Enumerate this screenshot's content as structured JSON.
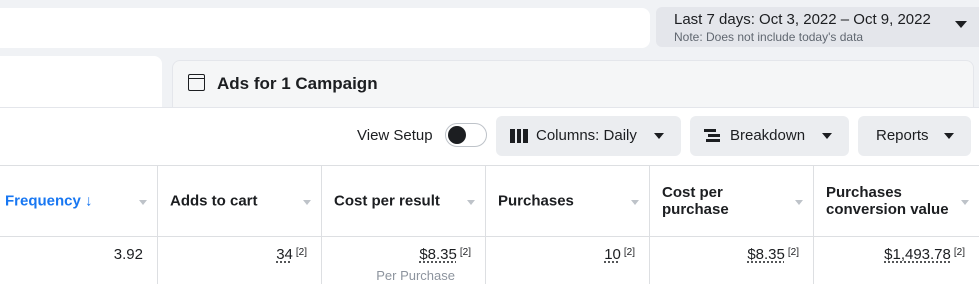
{
  "date_range": {
    "label": "Last 7 days: Oct 3, 2022 – Oct 9, 2022",
    "note": "Note: Does not include today's data"
  },
  "tab": {
    "title": "Ads for 1 Campaign"
  },
  "toolbar": {
    "view_setup_label": "View Setup",
    "view_setup_on": false,
    "columns_label": "Columns: Daily",
    "breakdown_label": "Breakdown",
    "reports_label": "Reports"
  },
  "table": {
    "headers": [
      {
        "label": "Frequency ↓"
      },
      {
        "label": "Adds to cart"
      },
      {
        "label": "Cost per result"
      },
      {
        "label": "Purchases"
      },
      {
        "label": "Cost per purchase"
      },
      {
        "label": "Purchases conversion value"
      }
    ],
    "row": [
      {
        "value": "3.92",
        "footnote": "",
        "sub": ""
      },
      {
        "value": "34",
        "footnote": "[2]",
        "sub": ""
      },
      {
        "value": "$8.35",
        "footnote": "[2]",
        "sub": "Per Purchase"
      },
      {
        "value": "10",
        "footnote": "[2]",
        "sub": ""
      },
      {
        "value": "$8.35",
        "footnote": "[2]",
        "sub": ""
      },
      {
        "value": "$1,493.78",
        "footnote": "[2]",
        "sub": ""
      }
    ]
  }
}
